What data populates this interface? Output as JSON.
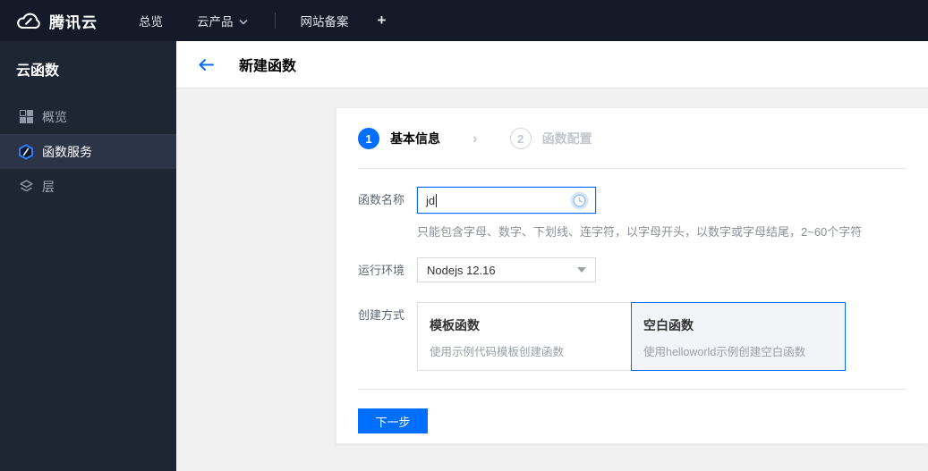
{
  "topbar": {
    "brand": "腾讯云",
    "nav": [
      {
        "label": "总览"
      },
      {
        "label": "云产品"
      },
      {
        "label": "网站备案"
      }
    ],
    "add_label": "+"
  },
  "sidebar": {
    "title": "云函数",
    "items": [
      {
        "label": "概览",
        "active": false
      },
      {
        "label": "函数服务",
        "active": true
      },
      {
        "label": "层",
        "active": false
      }
    ]
  },
  "header": {
    "title": "新建函数"
  },
  "wizard": {
    "separator": "›",
    "steps": [
      {
        "number": "1",
        "label": "基本信息",
        "state": "active"
      },
      {
        "number": "2",
        "label": "函数配置",
        "state": "inactive"
      }
    ]
  },
  "form": {
    "name": {
      "label": "函数名称",
      "value": "jd",
      "help": "只能包含字母、数字、下划线、连字符，以字母开头，以数字或字母结尾，2~60个字符",
      "status_icon": "validating-clock"
    },
    "runtime": {
      "label": "运行环境",
      "value": "Nodejs 12.16"
    },
    "method": {
      "label": "创建方式",
      "options": [
        {
          "title": "模板函数",
          "desc": "使用示例代码模板创建函数",
          "selected": false
        },
        {
          "title": "空白函数",
          "desc": "使用helloworld示例创建空白函数",
          "selected": true
        }
      ]
    },
    "next_label": "下一步"
  },
  "colors": {
    "accent": "#006eff",
    "topbar_bg": "#141a28",
    "sidebar_bg": "#1e2634",
    "sidebar_selected_bg": "#2c3547",
    "page_bg": "#f1f1f2",
    "selected_option_bg": "#f3f4f7"
  }
}
